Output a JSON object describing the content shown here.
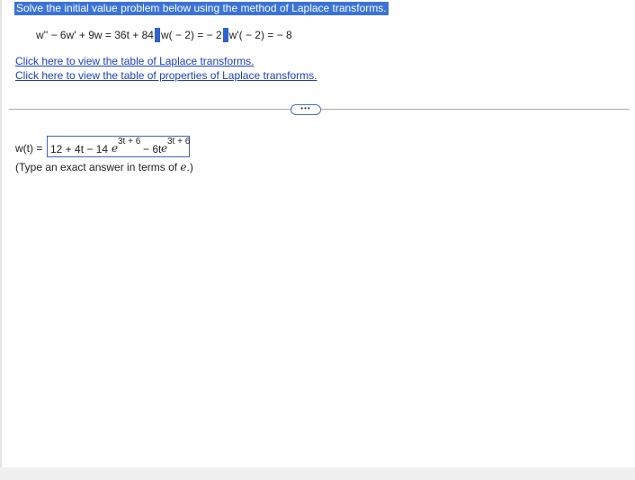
{
  "question": {
    "instruction": "Solve the initial value problem below using the method of Laplace transforms.",
    "equation": {
      "ode": "w'' − 6w' + 9w = 36t + 84",
      "initial_condition_1": "w( − 2) = − 2",
      "initial_condition_2": "w'( − 2) = − 8"
    }
  },
  "links": {
    "laplace_table": "Click here to view the table of Laplace transforms.",
    "properties_table": "Click here to view the table of properties of Laplace transforms."
  },
  "more_button": {
    "label": "•••"
  },
  "answer": {
    "label": "w(t) =",
    "value": {
      "part1": "12 + 4t − 14",
      "e1": "e",
      "exp1": "3t + 6",
      "part2": " − 6t",
      "e2": "e",
      "exp2": "3t + 6"
    }
  },
  "hint": {
    "prefix": "(Type an exact answer in terms of ",
    "variable": "e",
    "suffix": ".)"
  },
  "colors": {
    "instruction_highlight": "#3a73d9",
    "link": "#1a3fc4",
    "answer_border": "#3e63c7"
  }
}
